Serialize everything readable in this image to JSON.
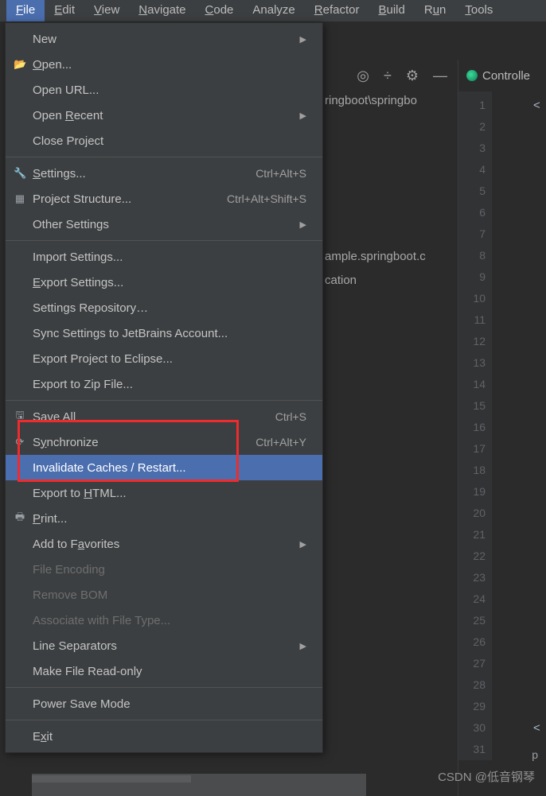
{
  "menubar": {
    "items": [
      {
        "label": "File",
        "mn": "F"
      },
      {
        "label": "Edit",
        "mn": "E"
      },
      {
        "label": "View",
        "mn": "V"
      },
      {
        "label": "Navigate",
        "mn": "N"
      },
      {
        "label": "Code",
        "mn": "C"
      },
      {
        "label": "Analyze",
        "mn": ""
      },
      {
        "label": "Refactor",
        "mn": "R"
      },
      {
        "label": "Build",
        "mn": "B"
      },
      {
        "label": "Run",
        "mn": "u"
      },
      {
        "label": "Tools",
        "mn": "T"
      }
    ]
  },
  "menu": {
    "new": "New",
    "open": "Open...",
    "open_url": "Open URL...",
    "open_recent": "Open Recent",
    "close_project": "Close Project",
    "settings": "Settings...",
    "settings_sc": "Ctrl+Alt+S",
    "project_structure": "Project Structure...",
    "project_structure_sc": "Ctrl+Alt+Shift+S",
    "other_settings": "Other Settings",
    "import_settings": "Import Settings...",
    "export_settings": "Export Settings...",
    "settings_repo": "Settings Repository…",
    "sync_settings": "Sync Settings to JetBrains Account...",
    "export_eclipse": "Export Project to Eclipse...",
    "export_zip": "Export to Zip File...",
    "save_all": "Save All",
    "save_all_sc": "Ctrl+S",
    "synchronize": "Synchronize",
    "synchronize_sc": "Ctrl+Alt+Y",
    "invalidate": "Invalidate Caches / Restart...",
    "export_html": "Export to HTML...",
    "print": "Print...",
    "add_favorites": "Add to Favorites",
    "file_encoding": "File Encoding",
    "remove_bom": "Remove BOM",
    "associate": "Associate with File Type...",
    "line_sep": "Line Separators",
    "readonly": "Make File Read-only",
    "power_save": "Power Save Mode",
    "exit": "Exit"
  },
  "tab": {
    "label": "Controlle"
  },
  "path_fragment": "ringboot\\springbo",
  "code_fragment1": "ample.springboot.c",
  "code_fragment2": "cation",
  "line_numbers": [
    "1",
    "2",
    "3",
    "4",
    "5",
    "6",
    "7",
    "8",
    "9",
    "10",
    "11",
    "12",
    "13",
    "14",
    "15",
    "16",
    "17",
    "18",
    "19",
    "20",
    "21",
    "22",
    "23",
    "24",
    "25",
    "26",
    "27",
    "28",
    "29",
    "30",
    "31"
  ],
  "code_tokens": {
    "lt1": "<",
    "lt2": "<"
  },
  "bottom_right": "p",
  "watermark": "CSDN @低音钢琴"
}
